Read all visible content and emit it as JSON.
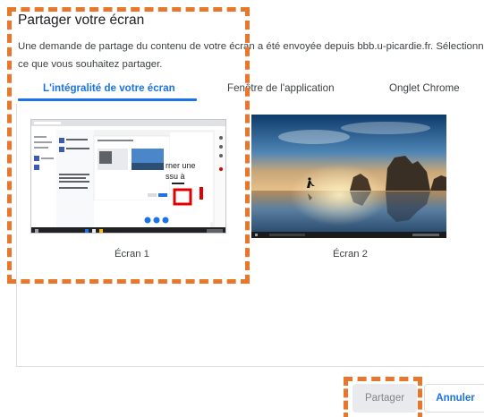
{
  "dialog": {
    "title": "Partager votre écran",
    "description": "Une demande de partage du contenu de votre écran a été envoyée depuis bbb.u-picardie.fr. Sélectionnez ce que vous souhaitez partager."
  },
  "tabs": [
    {
      "label": "L'intégralité de votre écran",
      "active": true
    },
    {
      "label": "Fenêtre de l'application",
      "active": false
    },
    {
      "label": "Onglet Chrome",
      "active": false
    }
  ],
  "screens": [
    {
      "label": "Écran 1",
      "selected": true
    },
    {
      "label": "Écran 2",
      "selected": false
    }
  ],
  "thumbnail_text": {
    "slide_line1": "rner une",
    "slide_line2": "ssu à"
  },
  "buttons": {
    "share": "Partager",
    "cancel": "Annuler"
  },
  "colors": {
    "accent": "#1a73e8",
    "highlight": "#e8762b"
  }
}
